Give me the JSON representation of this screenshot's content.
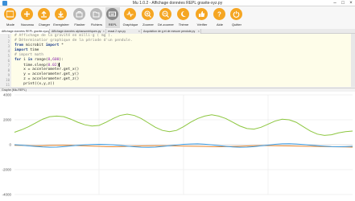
{
  "window": {
    "title": "Mu 1.0.2 - Affichage données REPL gravite-xyz.py"
  },
  "toolbar": {
    "buttons": [
      {
        "id": "mode",
        "label": "Mode",
        "icon": "mode-icon",
        "state": "normal"
      },
      {
        "id": "new",
        "label": "Nouveau",
        "icon": "plus-icon",
        "state": "normal"
      },
      {
        "id": "load",
        "label": "Charger",
        "icon": "upload-icon",
        "state": "normal"
      },
      {
        "id": "save",
        "label": "Enregistrer",
        "icon": "download-icon",
        "state": "normal"
      },
      {
        "id": "flash",
        "label": "Flasher",
        "icon": "flash-icon",
        "state": "disabled"
      },
      {
        "id": "files",
        "label": "Fichiers",
        "icon": "files-icon",
        "state": "disabled"
      },
      {
        "id": "repl",
        "label": "REPL",
        "icon": "keyboard-icon",
        "state": "active"
      },
      {
        "id": "plotter",
        "label": "Graphique",
        "icon": "graph-icon",
        "state": "normal"
      },
      {
        "id": "zoom-in",
        "label": "Zoomer",
        "icon": "zoom-in-icon",
        "state": "normal"
      },
      {
        "id": "zoom-out",
        "label": "Dé-zoomer",
        "icon": "zoom-out-icon",
        "state": "normal"
      },
      {
        "id": "theme",
        "label": "Thème",
        "icon": "moon-icon",
        "state": "normal"
      },
      {
        "id": "check",
        "label": "Vérifier",
        "icon": "thumbs-up-icon",
        "state": "normal"
      },
      {
        "id": "help",
        "label": "Aide",
        "icon": "question-icon",
        "state": "normal"
      },
      {
        "id": "quit",
        "label": "Quitter",
        "icon": "power-icon",
        "state": "normal"
      }
    ]
  },
  "tabs": [
    {
      "label": "Affichage données REPL gravite-xyz.py",
      "active": true
    },
    {
      "label": "Affichage données alphanumériques.py",
      "active": false
    },
    {
      "label": "essai 2 xyz.py",
      "active": false
    },
    {
      "label": "Acquisition de g et de mesure pendule.py",
      "active": false
    }
  ],
  "editor": {
    "lines": [
      "# Affichage de la gravité en milli-g ( mg ).",
      "# Déterminatior graphique de la période d'un pendule.",
      "from microbit import *",
      "import time",
      "# import math",
      "for i in range(0,600):",
      "    time.sleep(0.02)",
      "    x = accelerometer.get_x()",
      "    y = accelerometer.get_y()",
      "    z = accelerometer.get_z()",
      "    print((x,y,z))"
    ],
    "line_numbers": [
      "1",
      "2",
      "3",
      "4",
      "5",
      "6",
      "7",
      "8",
      "9",
      "10",
      "11"
    ]
  },
  "plotter": {
    "label": "Graphe (Mlc-REPL)",
    "y_ticks": [
      "4000",
      "2000",
      "0",
      "-2000",
      "-4000"
    ]
  },
  "chart_data": {
    "type": "line",
    "title": "",
    "xlabel": "",
    "ylabel": "",
    "ylim": [
      -4000,
      4000
    ],
    "grid": true,
    "series": [
      {
        "color": "#8cc63f",
        "values": [
          1000,
          1200,
          1450,
          1750,
          2050,
          2250,
          2300,
          2250,
          2050,
          1800,
          1600,
          1500,
          1550,
          1800,
          2100,
          2350,
          2450,
          2350,
          2100,
          1750,
          1400,
          1150,
          1050,
          1150,
          1450,
          1800,
          2100,
          2300,
          2400,
          2300,
          2100,
          1800,
          1500,
          1300,
          1250,
          1400,
          1650,
          1900,
          2050,
          2000,
          1800,
          1450,
          1100,
          850,
          750,
          800,
          950,
          1050,
          1100
        ]
      },
      {
        "color": "#e8872f",
        "values": [
          -50,
          -60,
          -80,
          -90,
          -80,
          -60,
          -50,
          -40,
          -50,
          -70,
          -90,
          -110,
          -130,
          -150,
          -160,
          -150,
          -130,
          -110,
          -100,
          -90,
          -80,
          -80,
          -90,
          -100,
          -110,
          -120,
          -130,
          -140,
          -150,
          -160,
          -150,
          -140,
          -120,
          -100,
          -80,
          -70,
          -70,
          -80,
          -90,
          -100,
          -110,
          -120,
          -130,
          -140,
          -150,
          -160,
          -170,
          -180,
          -190
        ]
      },
      {
        "color": "#3b9ae1",
        "values": [
          0,
          -40,
          -90,
          -140,
          -180,
          -200,
          -190,
          -150,
          -100,
          -50,
          -10,
          20,
          30,
          20,
          -10,
          -60,
          -110,
          -160,
          -200,
          -210,
          -190,
          -140,
          -80,
          -20,
          30,
          60,
          70,
          40,
          -10,
          -70,
          -130,
          -180,
          -200,
          -190,
          -150,
          -90,
          -30,
          30,
          70,
          80,
          60,
          20,
          -30,
          -80,
          -120,
          -150,
          -160,
          -150,
          -130
        ]
      }
    ]
  }
}
